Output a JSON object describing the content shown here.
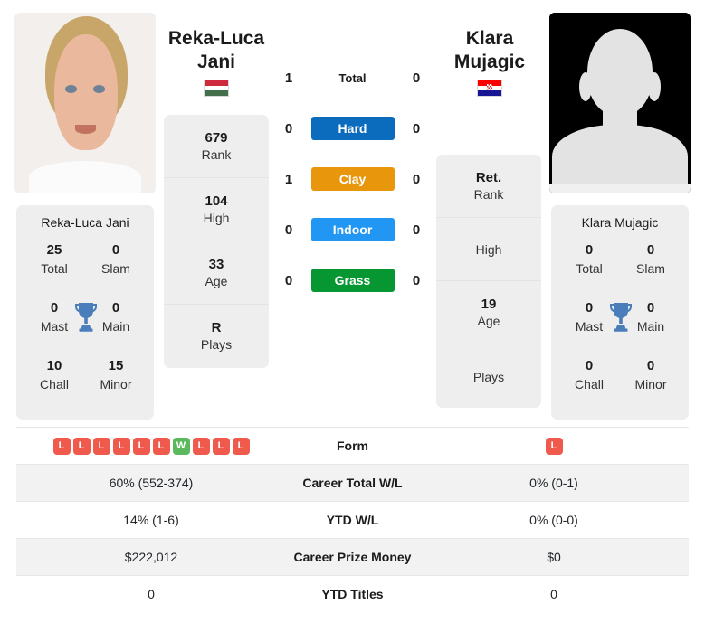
{
  "players": {
    "left": {
      "name_line1": "Reka-Luca",
      "name_line2": "Jani",
      "full_name": "Reka-Luca Jani",
      "country": "Hungary",
      "flag_colors": [
        "#cd2a3e",
        "#ffffff",
        "#436f4d"
      ],
      "photo_type": "portrait-photo",
      "info": [
        {
          "value": "679",
          "label": "Rank"
        },
        {
          "value": "104",
          "label": "High"
        },
        {
          "value": "33",
          "label": "Age"
        },
        {
          "value": "R",
          "label": "Plays"
        }
      ],
      "titles": {
        "total": "25",
        "slam": "0",
        "mast": "0",
        "main": "0",
        "chall": "10",
        "minor": "15"
      },
      "form": [
        "L",
        "L",
        "L",
        "L",
        "L",
        "L",
        "W",
        "L",
        "L",
        "L"
      ]
    },
    "right": {
      "name_line1": "Klara",
      "name_line2": "Mujagic",
      "full_name": "Klara Mujagic",
      "country": "Croatia",
      "flag_colors": [
        "#ff0000",
        "#ffffff",
        "#171796"
      ],
      "photo_type": "silhouette-placeholder",
      "info": [
        {
          "value": "Ret.",
          "label": "Rank"
        },
        {
          "value": "",
          "label": "High"
        },
        {
          "value": "19",
          "label": "Age"
        },
        {
          "value": "",
          "label": "Plays"
        }
      ],
      "titles": {
        "total": "0",
        "slam": "0",
        "mast": "0",
        "main": "0",
        "chall": "0",
        "minor": "0"
      },
      "form": [
        "L"
      ]
    }
  },
  "titles_labels": {
    "total": "Total",
    "slam": "Slam",
    "mast": "Mast",
    "main": "Main",
    "chall": "Chall",
    "minor": "Minor"
  },
  "head_to_head": [
    {
      "label": "Total",
      "left": "1",
      "right": "0",
      "styled": false,
      "color": ""
    },
    {
      "label": "Hard",
      "left": "0",
      "right": "0",
      "styled": true,
      "color": "#0b6cbd"
    },
    {
      "label": "Clay",
      "left": "1",
      "right": "0",
      "styled": true,
      "color": "#e8960c"
    },
    {
      "label": "Indoor",
      "left": "0",
      "right": "0",
      "styled": true,
      "color": "#2196f3"
    },
    {
      "label": "Grass",
      "left": "0",
      "right": "0",
      "styled": true,
      "color": "#069632"
    }
  ],
  "table_rows": [
    {
      "label": "Form",
      "left": "",
      "right": "",
      "is_form": true,
      "shaded": false
    },
    {
      "label": "Career Total W/L",
      "left": "60% (552-374)",
      "right": "0% (0-1)",
      "is_form": false,
      "shaded": true
    },
    {
      "label": "YTD W/L",
      "left": "14% (1-6)",
      "right": "0% (0-0)",
      "is_form": false,
      "shaded": false
    },
    {
      "label": "Career Prize Money",
      "left": "$222,012",
      "right": "$0",
      "is_form": false,
      "shaded": true
    },
    {
      "label": "YTD Titles",
      "left": "0",
      "right": "0",
      "is_form": false,
      "shaded": false
    }
  ],
  "colors": {
    "win_badge": "#5cb85c",
    "loss_badge": "#ef5a4c",
    "trophy": "#4a7ebb",
    "card_bg": "#eeeeee",
    "row_shaded": "#f2f2f2"
  }
}
